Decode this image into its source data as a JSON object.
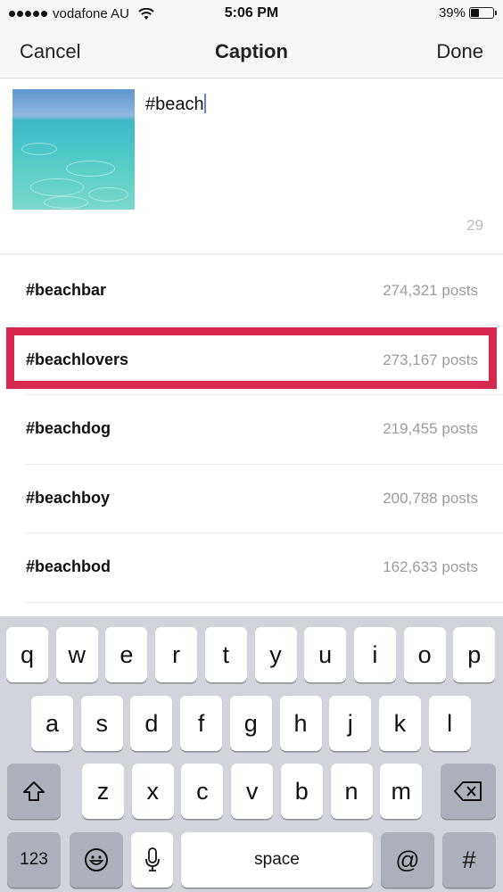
{
  "status_bar": {
    "carrier": "vodafone AU",
    "signal_bars": 5,
    "time": "5:06 PM",
    "battery_percent_label": "39%",
    "battery_level": 0.39
  },
  "nav": {
    "cancel_label": "Cancel",
    "title": "Caption",
    "done_label": "Done"
  },
  "caption": {
    "text": "#beach",
    "thumbnail": "ocean-water-photo",
    "char_count": "29"
  },
  "suggestions": [
    {
      "tag": "#beachbar",
      "count": "274,321 posts"
    },
    {
      "tag": "#beachlovers",
      "count": "273,167 posts",
      "highlighted": true
    },
    {
      "tag": "#beachdog",
      "count": "219,455 posts"
    },
    {
      "tag": "#beachboy",
      "count": "200,788 posts"
    },
    {
      "tag": "#beachbod",
      "count": "162,633 posts"
    }
  ],
  "highlight_color": "#d6274f",
  "keyboard": {
    "row1": [
      "q",
      "w",
      "e",
      "r",
      "t",
      "y",
      "u",
      "i",
      "o",
      "p"
    ],
    "row2": [
      "a",
      "s",
      "d",
      "f",
      "g",
      "h",
      "j",
      "k",
      "l"
    ],
    "row3": [
      "z",
      "x",
      "c",
      "v",
      "b",
      "n",
      "m"
    ],
    "shift_icon": "shift-arrow-icon",
    "delete_icon": "backspace-icon",
    "numbers_label": "123",
    "emoji_icon": "emoji-icon",
    "mic_icon": "microphone-icon",
    "space_label": "space",
    "at_label": "@",
    "hash_label": "#"
  }
}
